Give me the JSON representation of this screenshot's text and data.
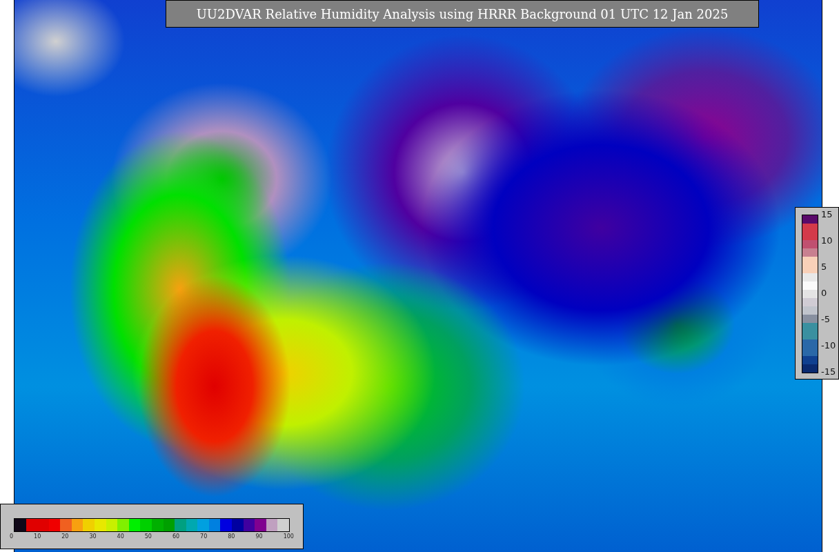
{
  "title": "UU2DVAR Relative Humidity Analysis using HRRR Background 01 UTC 12 Jan 2025",
  "humidity_legend": {
    "ticks": [
      "0",
      "10",
      "20",
      "30",
      "40",
      "50",
      "60",
      "70",
      "80",
      "90",
      "100"
    ],
    "segments": [
      {
        "color": "#100818"
      },
      {
        "color": "#e00000"
      },
      {
        "color": "#e00000"
      },
      {
        "color": "#f00000"
      },
      {
        "color": "#f06020"
      },
      {
        "color": "#f8a010"
      },
      {
        "color": "#f0d000"
      },
      {
        "color": "#e8e800"
      },
      {
        "color": "#c8f000"
      },
      {
        "color": "#80f000"
      },
      {
        "color": "#00f000"
      },
      {
        "color": "#00d000"
      },
      {
        "color": "#00b000"
      },
      {
        "color": "#00a000"
      },
      {
        "color": "#00a080"
      },
      {
        "color": "#00a8b0"
      },
      {
        "color": "#00a0e0"
      },
      {
        "color": "#0080e0"
      },
      {
        "color": "#0000e0"
      },
      {
        "color": "#0000a0"
      },
      {
        "color": "#4000a0"
      },
      {
        "color": "#800090"
      },
      {
        "color": "#c0a0c0"
      },
      {
        "color": "#d0d0d0"
      }
    ]
  },
  "difference_legend": {
    "ticks": [
      "15",
      "10",
      "5",
      "0",
      "-5",
      "-10",
      "-15"
    ],
    "segments": [
      {
        "color": "#5a0a6a"
      },
      {
        "color": "#d43a4a"
      },
      {
        "color": "#d43a4a"
      },
      {
        "color": "#c05070"
      },
      {
        "color": "#c88090"
      },
      {
        "color": "#f8d0b8"
      },
      {
        "color": "#f8d0b8"
      },
      {
        "color": "#e8e8e8"
      },
      {
        "color": "#fafafa"
      },
      {
        "color": "#e4e4e4"
      },
      {
        "color": "#d0ccd4"
      },
      {
        "color": "#c0c4cc"
      },
      {
        "color": "#8890a0"
      },
      {
        "color": "#3a90a0"
      },
      {
        "color": "#3a90a0"
      },
      {
        "color": "#2a68a8"
      },
      {
        "color": "#2a68a8"
      },
      {
        "color": "#104090"
      },
      {
        "color": "#0a2a70"
      }
    ]
  }
}
